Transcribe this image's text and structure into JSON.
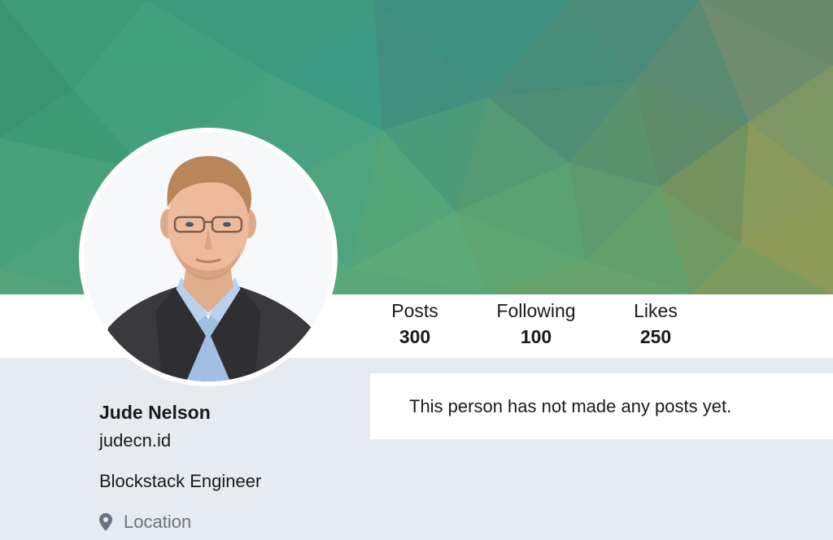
{
  "profile": {
    "name": "Jude Nelson",
    "handle": "judecn.id",
    "bio": "Blockstack Engineer",
    "location_label": "Location",
    "location_icon": "map-pin-icon"
  },
  "stats": {
    "posts_label": "Posts",
    "posts_value": "300",
    "following_label": "Following",
    "following_value": "100",
    "likes_label": "Likes",
    "likes_value": "250"
  },
  "feed": {
    "empty_message": "This person has not made any posts yet."
  },
  "colors": {
    "page_background": "#e6ebef",
    "panel_background": "#ffffff",
    "text": "#1a1a1a",
    "muted_text": "#6b7480",
    "cover_primary": "#4a9a7a"
  }
}
